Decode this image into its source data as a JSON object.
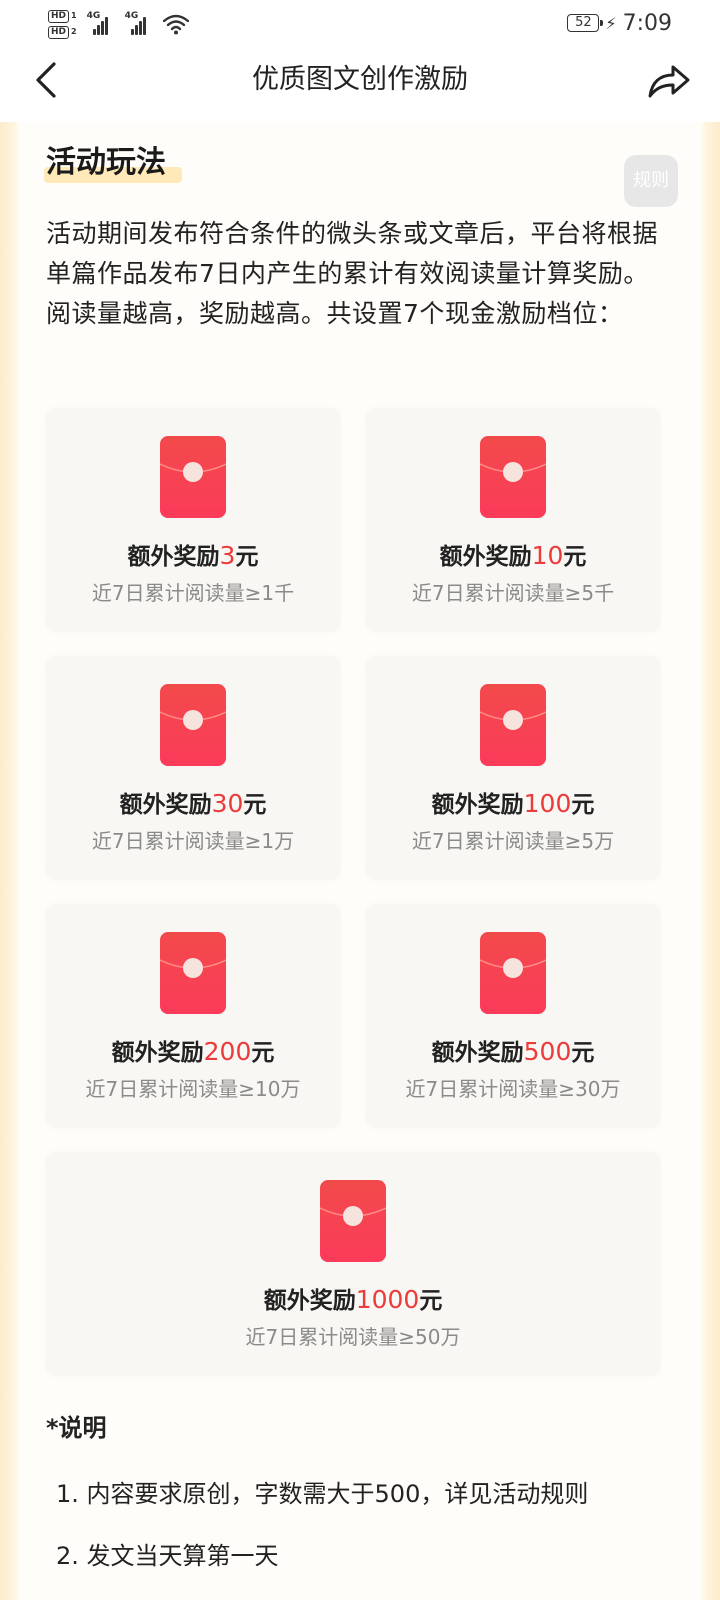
{
  "status_bar": {
    "hd1": "HD",
    "hd1_num": "1",
    "hd2": "HD",
    "hd2_num": "2",
    "net1": "4G",
    "net2": "4G",
    "battery": "52",
    "time": "7:09"
  },
  "nav": {
    "title": "优质图文创作激励"
  },
  "section": {
    "title": "活动玩法",
    "rules_label": "规则",
    "description": "活动期间发布符合条件的微头条或文章后，平台将根据单篇作品发布7日内产生的累计有效阅读量计算奖励。阅读量越高，奖励越高。共设置7个现金激励档位："
  },
  "rewards": [
    {
      "prefix": "额外奖励",
      "amount": "3",
      "unit": "元",
      "condition": "近7日累计阅读量≥1千"
    },
    {
      "prefix": "额外奖励",
      "amount": "10",
      "unit": "元",
      "condition": "近7日累计阅读量≥5千"
    },
    {
      "prefix": "额外奖励",
      "amount": "30",
      "unit": "元",
      "condition": "近7日累计阅读量≥1万"
    },
    {
      "prefix": "额外奖励",
      "amount": "100",
      "unit": "元",
      "condition": "近7日累计阅读量≥5万"
    },
    {
      "prefix": "额外奖励",
      "amount": "200",
      "unit": "元",
      "condition": "近7日累计阅读量≥10万"
    },
    {
      "prefix": "额外奖励",
      "amount": "500",
      "unit": "元",
      "condition": "近7日累计阅读量≥30万"
    },
    {
      "prefix": "额外奖励",
      "amount": "1000",
      "unit": "元",
      "condition": "近7日累计阅读量≥50万"
    }
  ],
  "notes": {
    "title": "*说明",
    "items": [
      "1. 内容要求原创，字数需大于500，详见活动规则",
      "2. 发文当天算第一天"
    ]
  },
  "colors": {
    "accent_red": "#ec3b3b",
    "envelope_top": "#f24a4a",
    "envelope_bottom": "#fb3b5a",
    "warm_frame": "#fdeccc"
  },
  "icons": [
    "back-arrow-icon",
    "share-icon",
    "red-envelope-icon",
    "wifi-icon",
    "signal-icon",
    "battery-icon"
  ]
}
